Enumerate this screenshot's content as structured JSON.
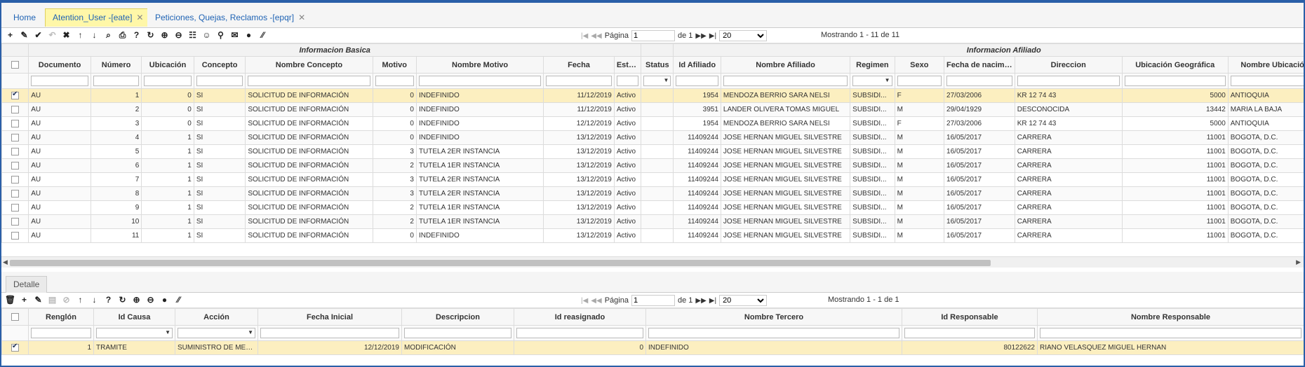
{
  "tabs": [
    {
      "label": "Home",
      "active": false,
      "closable": false
    },
    {
      "label": "Atention_User -[eate]",
      "active": true,
      "closable": true
    },
    {
      "label": "Peticiones, Quejas, Reclamos -[epqr]",
      "active": false,
      "closable": true
    }
  ],
  "toolbar_icons": [
    "plus-icon",
    "edit-icon",
    "check-icon",
    "undo-icon",
    "delete-icon",
    "arrow-up-icon",
    "arrow-down-icon",
    "search-icon",
    "print-icon",
    "help-icon",
    "refresh-icon",
    "zoom-icon",
    "zoom-alt-icon",
    "comment-icon",
    "user-icon",
    "pin-icon",
    "mail-icon",
    "add-circle-icon",
    "resize-icon"
  ],
  "pager": {
    "first": "|◀",
    "prev": "◀◀",
    "page_label": "Página",
    "page_value": "1",
    "of_label": "de 1",
    "next": "▶▶",
    "last": "▶|",
    "page_size": "20",
    "showing": "Mostrando 1 - 11 de 11"
  },
  "main_groups": [
    "Informacion Basica",
    "Informacion Afiliado"
  ],
  "main_columns": [
    "Documento",
    "Número",
    "Ubicación",
    "Concepto",
    "Nombre Concepto",
    "Motivo",
    "Nombre Motivo",
    "Fecha",
    "Estado",
    "Status",
    "Id Afiliado",
    "Nombre Afiliado",
    "Regimen",
    "Sexo",
    "Fecha de nacimien",
    "Direccion",
    "Ubicación Geográfica",
    "Nombre Ubicación Ge"
  ],
  "main_rows": [
    [
      "AU",
      "1",
      "0",
      "SI",
      "SOLICITUD DE INFORMACIÓN",
      "0",
      "INDEFINIDO",
      "11/12/2019",
      "Activo",
      "",
      "1954",
      "MENDOZA BERRIO SARA NELSI",
      "SUBSIDI...",
      "F",
      "27/03/2006",
      "KR 12 74 43",
      "5000",
      "ANTIOQUIA"
    ],
    [
      "AU",
      "2",
      "0",
      "SI",
      "SOLICITUD DE INFORMACIÓN",
      "0",
      "INDEFINIDO",
      "11/12/2019",
      "Activo",
      "",
      "3951",
      "LANDER OLIVERA TOMAS MIGUEL",
      "SUBSIDI...",
      "M",
      "29/04/1929",
      "DESCONOCIDA",
      "13442",
      "MARIA LA BAJA"
    ],
    [
      "AU",
      "3",
      "0",
      "SI",
      "SOLICITUD DE INFORMACIÓN",
      "0",
      "INDEFINIDO",
      "12/12/2019",
      "Activo",
      "",
      "1954",
      "MENDOZA BERRIO SARA NELSI",
      "SUBSIDI...",
      "F",
      "27/03/2006",
      "KR 12 74 43",
      "5000",
      "ANTIOQUIA"
    ],
    [
      "AU",
      "4",
      "1",
      "SI",
      "SOLICITUD DE INFORMACIÓN",
      "0",
      "INDEFINIDO",
      "13/12/2019",
      "Activo",
      "",
      "11409244",
      "JOSE HERNAN MIGUEL SILVESTRE",
      "SUBSIDI...",
      "M",
      "16/05/2017",
      "CARRERA",
      "11001",
      "BOGOTA, D.C."
    ],
    [
      "AU",
      "5",
      "1",
      "SI",
      "SOLICITUD DE INFORMACIÓN",
      "3",
      "TUTELA 2ER INSTANCIA",
      "13/12/2019",
      "Activo",
      "",
      "11409244",
      "JOSE HERNAN MIGUEL SILVESTRE",
      "SUBSIDI...",
      "M",
      "16/05/2017",
      "CARRERA",
      "11001",
      "BOGOTA, D.C."
    ],
    [
      "AU",
      "6",
      "1",
      "SI",
      "SOLICITUD DE INFORMACIÓN",
      "2",
      "TUTELA 1ER INSTANCIA",
      "13/12/2019",
      "Activo",
      "",
      "11409244",
      "JOSE HERNAN MIGUEL SILVESTRE",
      "SUBSIDI...",
      "M",
      "16/05/2017",
      "CARRERA",
      "11001",
      "BOGOTA, D.C."
    ],
    [
      "AU",
      "7",
      "1",
      "SI",
      "SOLICITUD DE INFORMACIÓN",
      "3",
      "TUTELA 2ER INSTANCIA",
      "13/12/2019",
      "Activo",
      "",
      "11409244",
      "JOSE HERNAN MIGUEL SILVESTRE",
      "SUBSIDI...",
      "M",
      "16/05/2017",
      "CARRERA",
      "11001",
      "BOGOTA, D.C."
    ],
    [
      "AU",
      "8",
      "1",
      "SI",
      "SOLICITUD DE INFORMACIÓN",
      "3",
      "TUTELA 2ER INSTANCIA",
      "13/12/2019",
      "Activo",
      "",
      "11409244",
      "JOSE HERNAN MIGUEL SILVESTRE",
      "SUBSIDI...",
      "M",
      "16/05/2017",
      "CARRERA",
      "11001",
      "BOGOTA, D.C."
    ],
    [
      "AU",
      "9",
      "1",
      "SI",
      "SOLICITUD DE INFORMACIÓN",
      "2",
      "TUTELA 1ER INSTANCIA",
      "13/12/2019",
      "Activo",
      "",
      "11409244",
      "JOSE HERNAN MIGUEL SILVESTRE",
      "SUBSIDI...",
      "M",
      "16/05/2017",
      "CARRERA",
      "11001",
      "BOGOTA, D.C."
    ],
    [
      "AU",
      "10",
      "1",
      "SI",
      "SOLICITUD DE INFORMACIÓN",
      "2",
      "TUTELA 1ER INSTANCIA",
      "13/12/2019",
      "Activo",
      "",
      "11409244",
      "JOSE HERNAN MIGUEL SILVESTRE",
      "SUBSIDI...",
      "M",
      "16/05/2017",
      "CARRERA",
      "11001",
      "BOGOTA, D.C."
    ],
    [
      "AU",
      "11",
      "1",
      "SI",
      "SOLICITUD DE INFORMACIÓN",
      "0",
      "INDEFINIDO",
      "13/12/2019",
      "Activo",
      "",
      "11409244",
      "JOSE HERNAN MIGUEL SILVESTRE",
      "SUBSIDI...",
      "M",
      "16/05/2017",
      "CARRERA",
      "11001",
      "BOGOTA, D.C."
    ]
  ],
  "detail_tab": "Detalle",
  "detail_toolbar_icons": [
    "trash-icon",
    "plus-icon",
    "edit-icon",
    "save-icon",
    "cancel-icon",
    "arrow-up-icon",
    "arrow-down-icon",
    "help-icon",
    "refresh-icon",
    "zoom-icon",
    "zoom-alt-icon",
    "add-circle-icon",
    "resize-icon"
  ],
  "detail_pager": {
    "first": "|◀",
    "prev": "◀◀",
    "page_label": "Página",
    "page_value": "1",
    "of_label": "de 1",
    "next": "▶▶",
    "last": "▶|",
    "page_size": "20",
    "showing": "Mostrando 1 - 1 de 1"
  },
  "detail_columns": [
    "Renglón",
    "Id Causa",
    "Acción",
    "Fecha Inicial",
    "Descripcion",
    "Id reasignado",
    "Nombre Tercero",
    "Id Responsable",
    "Nombre Responsable"
  ],
  "detail_rows": [
    [
      "1",
      "TRAMITE",
      "SUMINISTRO DE MED...",
      "12/12/2019",
      "MODIFICACIÓN",
      "0",
      "INDEFINIDO",
      "80122622",
      "RIANO VELASQUEZ MIGUEL HERNAN"
    ]
  ]
}
